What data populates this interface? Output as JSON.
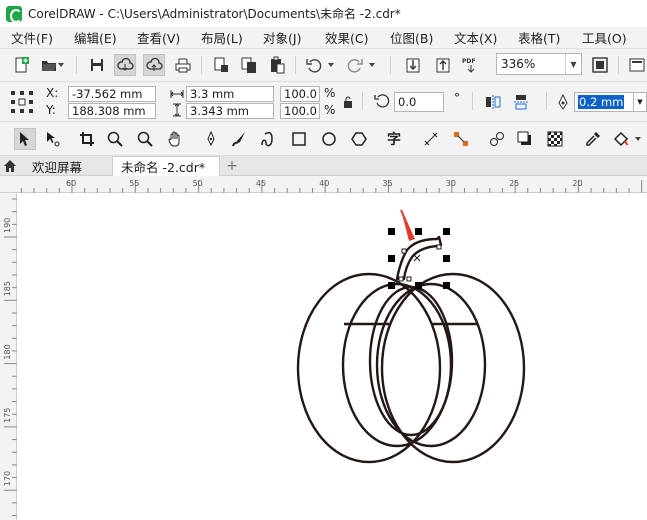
{
  "app": {
    "title": "CorelDRAW - C:\\Users\\Administrator\\Documents\\未命名 -2.cdr*",
    "logo_icon": "coreldraw-logo-icon"
  },
  "menu": [
    {
      "label": "文件(F)"
    },
    {
      "label": "编辑(E)"
    },
    {
      "label": "查看(V)"
    },
    {
      "label": "布局(L)"
    },
    {
      "label": "对象(J)"
    },
    {
      "label": "效果(C)"
    },
    {
      "label": "位图(B)"
    },
    {
      "label": "文本(X)"
    },
    {
      "label": "表格(T)"
    },
    {
      "label": "工具(O)"
    }
  ],
  "toolbar": {
    "zoom_value": "336%"
  },
  "properties": {
    "x_label": "X:",
    "y_label": "Y:",
    "x_value": "-37.562 mm",
    "y_value": "188.308 mm",
    "width_value": "3.3 mm",
    "height_value": "3.343 mm",
    "scale_x": "100.0",
    "scale_y": "100.0",
    "percent_symbol": "%",
    "rotation_value": "0.0",
    "rotation_unit": "°",
    "outline_width": "0.2 mm"
  },
  "tabs": [
    {
      "label": "欢迎屏幕"
    },
    {
      "label": "未命名 -2.cdr*"
    }
  ],
  "ruler": {
    "horizontal_labels": [
      "60",
      "55",
      "50",
      "45",
      "40",
      "35",
      "30",
      "25",
      "20"
    ],
    "vertical_labels": [
      "190",
      "185",
      "180",
      "175",
      "170"
    ]
  },
  "colors": {
    "chrome_bg": "#f3f3f3",
    "selection_blue": "#0b63c9",
    "annotation_red": "#e03a2a",
    "drawing_stroke": "#231815"
  }
}
